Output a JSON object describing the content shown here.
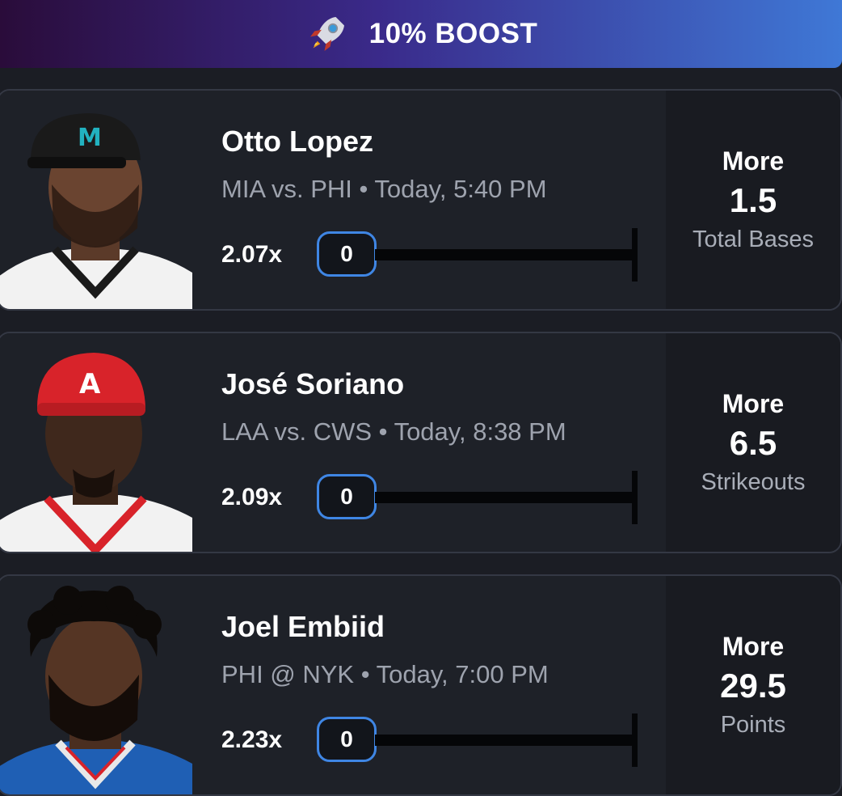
{
  "banner": {
    "icon": "rocket-icon",
    "label": "10% BOOST",
    "gradient": [
      "#2a0c3a",
      "#3a2a8a",
      "#3f78d6"
    ]
  },
  "accent": "#3f86e4",
  "picks": [
    {
      "player": "Otto Lopez",
      "game": "MIA vs. PHI • Today, 5:40 PM",
      "multiplier": "2.07x",
      "count": "0",
      "direction": "More",
      "line": "1.5",
      "stat": "Total Bases",
      "headwear": "cap",
      "cap_color": "#1a1a1a",
      "jersey_color": "#f2f2f2"
    },
    {
      "player": "José Soriano",
      "game": "LAA vs. CWS • Today, 8:38 PM",
      "multiplier": "2.09x",
      "count": "0",
      "direction": "More",
      "line": "6.5",
      "stat": "Strikeouts",
      "headwear": "cap",
      "cap_color": "#d8232a",
      "jersey_color": "#f2f2f2"
    },
    {
      "player": "Joel Embiid",
      "game": "PHI @ NYK • Today, 7:00 PM",
      "multiplier": "2.23x",
      "count": "0",
      "direction": "More",
      "line": "29.5",
      "stat": "Points",
      "headwear": "hair",
      "cap_color": "#111111",
      "jersey_color": "#1f5fb4"
    }
  ]
}
